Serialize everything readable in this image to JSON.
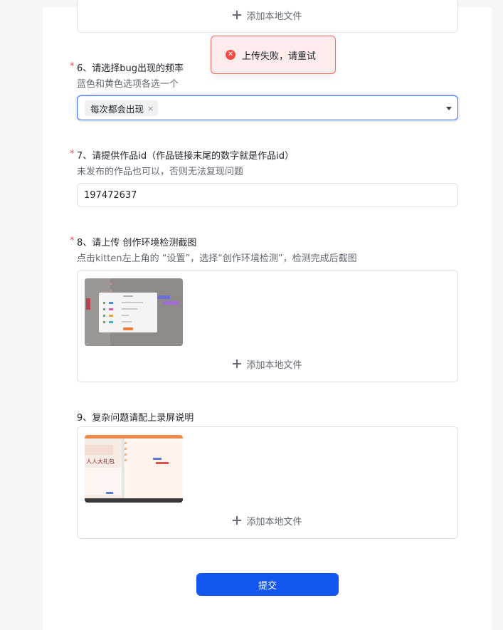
{
  "upload": {
    "add_label": "添加本地文件"
  },
  "toast": {
    "message": "上传失败，请重试"
  },
  "q6": {
    "required": "*",
    "title": "6、请选择bug出现的频率",
    "desc": "蓝色和黄色选项各选一个",
    "selected_tag": "每次都会出现",
    "tag_close": "×"
  },
  "q7": {
    "required": "*",
    "title": "7、请提供作品id（作品链接末尾的数字就是作品id）",
    "desc": "未发布的作品也可以，否则无法复现问题",
    "value": "197472637"
  },
  "q8": {
    "required": "*",
    "title": "8、请上传 创作环境检测截图",
    "desc": "点击kitten左上角的 “设置”，选择“创作环境检测”，检测完成后截图"
  },
  "q9": {
    "title": "9、复杂问题请配上录屏说明",
    "thumb_text": "人人大礼包"
  },
  "submit": {
    "label": "提交"
  },
  "colors": {
    "primary": "#1456f0",
    "required": "#f54a45",
    "toast_bg": "#fdecec",
    "border": "#dee0e3"
  }
}
